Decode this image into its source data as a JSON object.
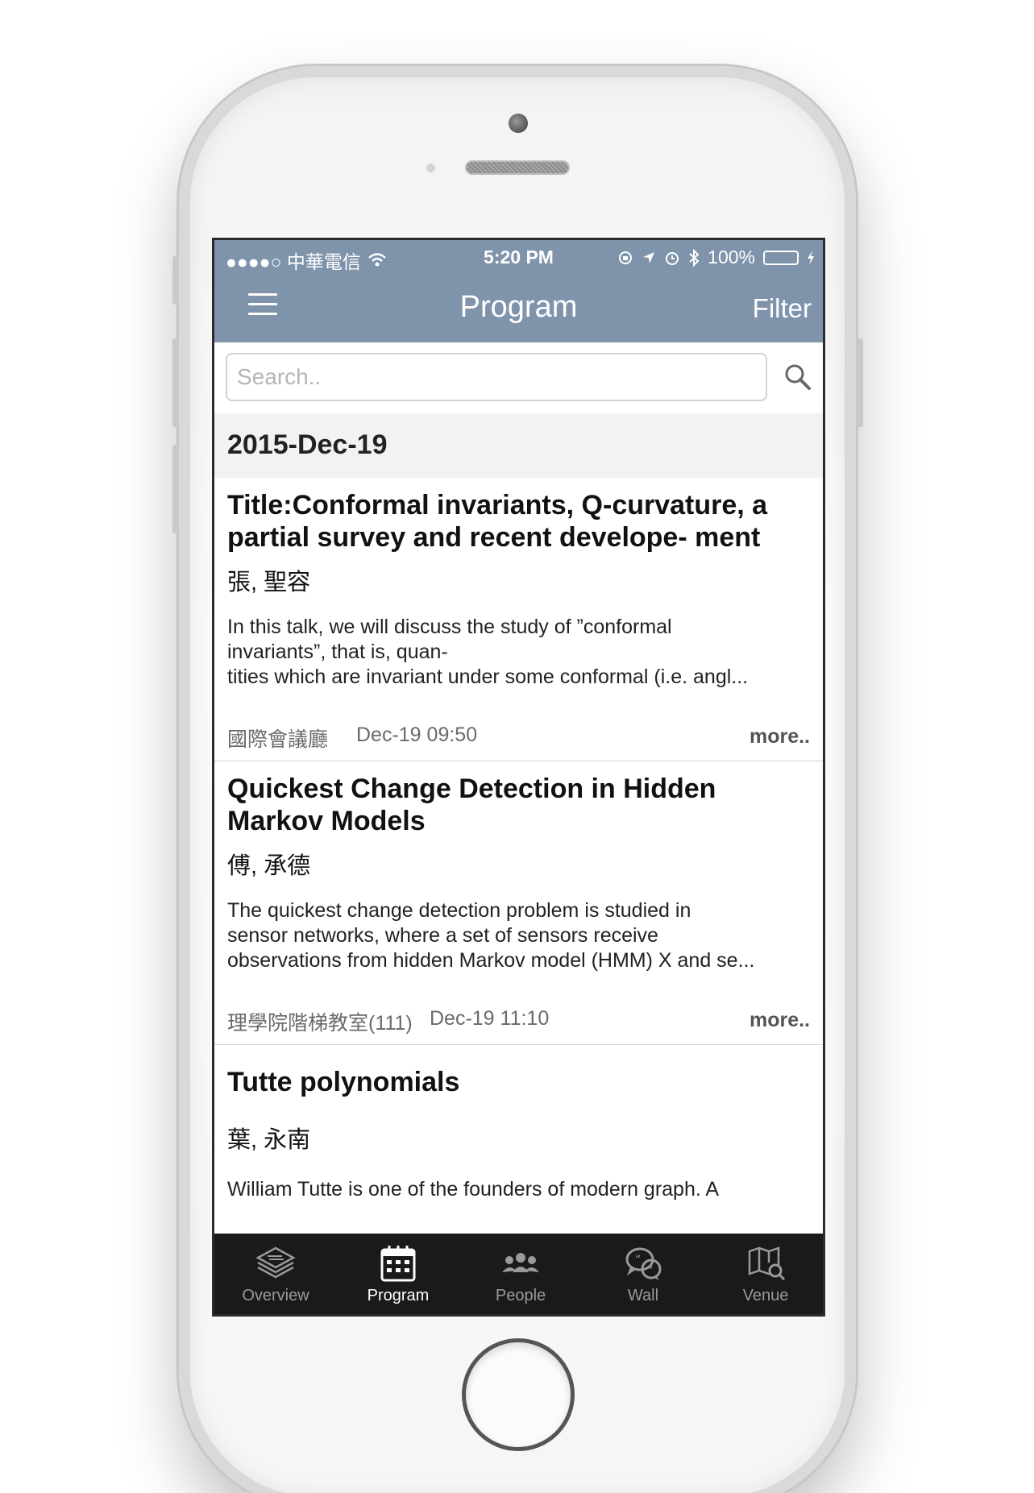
{
  "status_bar": {
    "carrier": "●●●●○ 中華電信",
    "time": "5:20 PM",
    "battery": "100%"
  },
  "nav": {
    "title": "Program",
    "filter_label": "Filter"
  },
  "search": {
    "placeholder": "Search.."
  },
  "date_header": "2015-Dec-19",
  "items": [
    {
      "title": "Title:Conformal invariants, Q-curvature, a partial survey and recent develope- ment",
      "speaker": "張, 聖容",
      "abstract_lines": [
        "In this talk, we will discuss the study of ”conformal",
        "invariants”, that is, quan-",
        "tities which are invariant under some conformal (i.e. angl..."
      ],
      "venue": "國際會議廳",
      "time": "Dec-19 09:50",
      "more": "more.."
    },
    {
      "title": "Quickest Change Detection in Hidden Markov Models",
      "speaker": "傅, 承德",
      "abstract_lines": [
        "The quickest change detection problem is studied in",
        "sensor networks, where a set of sensors receive",
        "observations from hidden Markov model (HMM) X and se..."
      ],
      "venue": "理學院階梯教室(111)",
      "time": "Dec-19 11:10",
      "more": "more.."
    },
    {
      "title": "Tutte polynomials",
      "speaker": "葉, 永南",
      "abstract_lines": [
        "William Tutte is one of the founders of modern graph. A"
      ]
    }
  ],
  "tabs": [
    {
      "label": "Overview",
      "icon": "layers-icon"
    },
    {
      "label": "Program",
      "icon": "calendar-icon",
      "active": true
    },
    {
      "label": "People",
      "icon": "people-icon"
    },
    {
      "label": "Wall",
      "icon": "chat-icon"
    },
    {
      "label": "Venue",
      "icon": "map-icon"
    }
  ],
  "colors": {
    "header": "#7f93ab",
    "tab_bar": "#1a1a1a",
    "battery": "#4cd964"
  }
}
